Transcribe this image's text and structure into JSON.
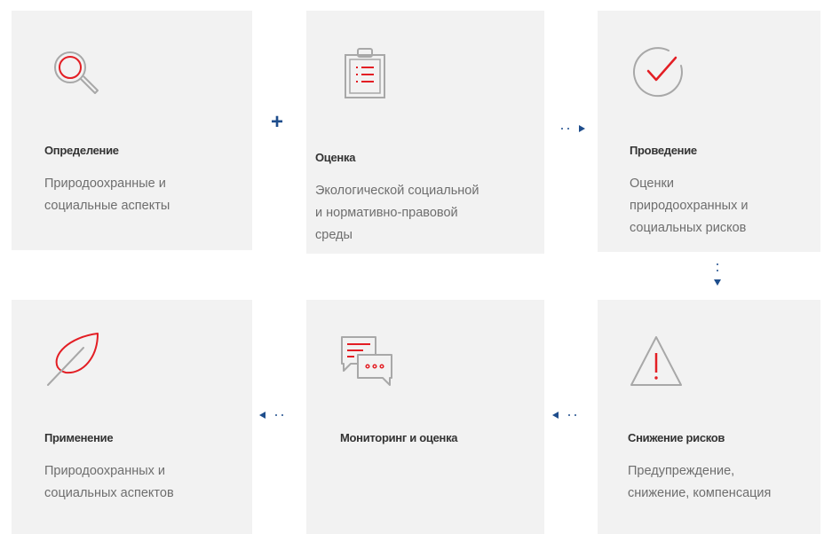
{
  "steps": [
    {
      "icon": "magnifier-icon",
      "title": "Определение",
      "desc": [
        "Природоохранные и",
        "социальные аспекты"
      ]
    },
    {
      "icon": "clipboard-list-icon",
      "title": "Оценка",
      "desc": [
        "Экологической социальной",
        "и нормативно-правовой",
        "среды"
      ]
    },
    {
      "icon": "checkmark-circle-icon",
      "title": "Проведение",
      "desc": [
        "Оценки",
        "природоохранных и",
        "социальных рисков"
      ]
    },
    {
      "icon": "leaf-icon",
      "title": "Применение",
      "desc": [
        "Природоохранных и",
        "социальных аспектов"
      ]
    },
    {
      "icon": "chat-bubbles-icon",
      "title": "Мониторинг и оценка",
      "desc": []
    },
    {
      "icon": "warning-triangle-icon",
      "title": "Снижение рисков",
      "desc": [
        "Предупреждение,",
        "снижение, компенсация"
      ]
    }
  ],
  "connectors": {
    "plus_symbol": "+",
    "plus_icon": "plus-icon",
    "arrow_icon": "dotted-arrow-icon"
  },
  "colors": {
    "card_bg": "#f2f2f2",
    "accent_red": "#e31e24",
    "icon_gray": "#a8a8a8",
    "connector_blue": "#1e4d8c"
  }
}
